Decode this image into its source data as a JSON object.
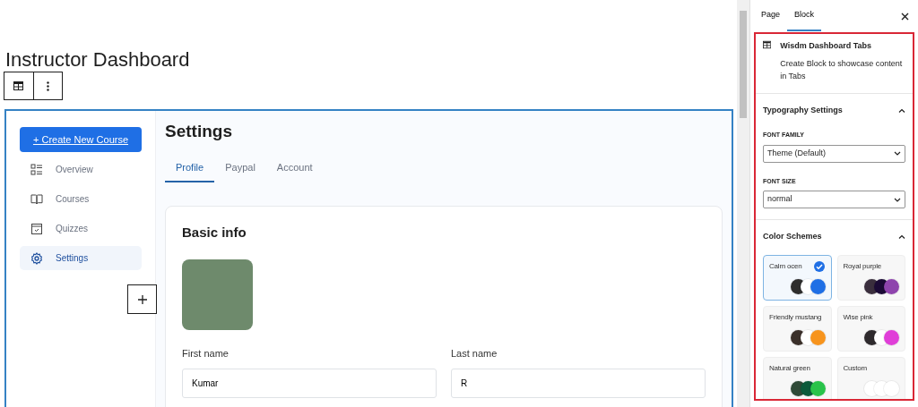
{
  "page_title": "Instructor Dashboard",
  "dashboard": {
    "create_button": "+ Create New Course",
    "nav": [
      {
        "label": "Overview",
        "selected": false
      },
      {
        "label": "Courses",
        "selected": false
      },
      {
        "label": "Quizzes",
        "selected": false
      },
      {
        "label": "Settings",
        "selected": true
      }
    ],
    "heading": "Settings",
    "tabs": [
      {
        "label": "Profile",
        "selected": true
      },
      {
        "label": "Paypal",
        "selected": false
      },
      {
        "label": "Account",
        "selected": false
      }
    ],
    "card_title": "Basic info",
    "fields": [
      {
        "label": "First name",
        "value": "Kumar"
      },
      {
        "label": "Last name",
        "value": "R"
      }
    ]
  },
  "sidebar": {
    "tabs": [
      {
        "label": "Page",
        "selected": false
      },
      {
        "label": "Block",
        "selected": true
      }
    ],
    "block_name": "Wisdm Dashboard Tabs",
    "block_description": "Create Block to showcase content in Tabs",
    "typography": {
      "title": "Typography Settings",
      "expanded": true,
      "font_family": {
        "label": "FONT FAMILY",
        "value": "Theme (Default)"
      },
      "font_size": {
        "label": "FONT SIZE",
        "value": "normal"
      }
    },
    "color_schemes": {
      "title": "Color Schemes",
      "expanded": true,
      "schemes": [
        {
          "name": "Calm ocen",
          "selected": true,
          "swatches": [
            {
              "color": "#2d2d2d"
            },
            {
              "color": "#ffffff"
            },
            {
              "color": "#1f6fe5"
            }
          ]
        },
        {
          "name": "Royal purple",
          "selected": false,
          "swatches": [
            {
              "color": "#3a2e3d"
            },
            {
              "color": "#1b0a35"
            },
            {
              "color": "#8e44ad"
            }
          ]
        },
        {
          "name": "Friendly mustang",
          "selected": false,
          "swatches": [
            {
              "color": "#3b302a"
            },
            {
              "color": "#ffffff"
            },
            {
              "color": "#f7941d"
            }
          ]
        },
        {
          "name": "Wise pink",
          "selected": false,
          "swatches": [
            {
              "color": "#2e2a2d"
            },
            {
              "color": "#ffffff"
            },
            {
              "color": "#e03fd8"
            }
          ]
        },
        {
          "name": "Natural green",
          "selected": false,
          "swatches": [
            {
              "color": "#2f4a37"
            },
            {
              "color": "#0b5a3a"
            },
            {
              "color": "#29c34a"
            }
          ]
        },
        {
          "name": "Custom",
          "selected": false,
          "swatches": [
            {
              "color": "#ffffff"
            },
            {
              "color": "#ffffff"
            },
            {
              "color": "#ffffff"
            }
          ]
        }
      ]
    }
  }
}
